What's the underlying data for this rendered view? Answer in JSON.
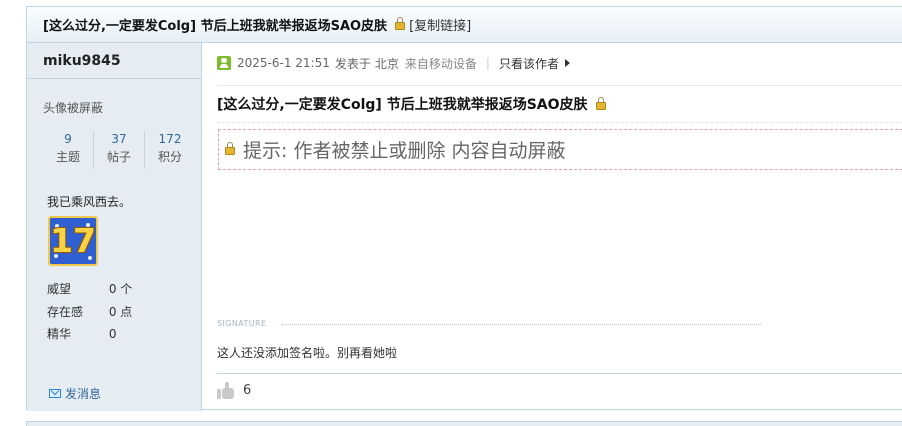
{
  "thread": {
    "title": "[这么过分,一定要发Colg] 节后上班我就举报返场SAO皮肤",
    "copy_link": "[复制链接]"
  },
  "author": {
    "name": "miku9845",
    "avatar_status": "头像被屏蔽",
    "stats": [
      {
        "value": "9",
        "label": "主题"
      },
      {
        "value": "37",
        "label": "帖子"
      },
      {
        "value": "172",
        "label": "积分"
      }
    ],
    "status_text": "我已乘风西去。",
    "medal": {
      "text": "17"
    },
    "attributes": [
      {
        "key": "威望",
        "value": "0 个"
      },
      {
        "key": "存在感",
        "value": "0 点"
      },
      {
        "key": "精华",
        "value": "0"
      }
    ],
    "message_link": "发消息"
  },
  "post": {
    "date": "2025-6-1 21:51",
    "posted_at_label": "发表于",
    "location": "北京",
    "device": "来自移动设备",
    "only_author": "只看该作者",
    "title": "[这么过分,一定要发Colg] 节后上班我就举报返场SAO皮肤",
    "locked_notice": "提示: 作者被禁止或删除 内容自动屏蔽",
    "signature_label": "SIGNATURE",
    "signature_text": "这人还没添加签名啦。别再看她啦",
    "likes": "6"
  },
  "colors": {
    "border": "#c2d5e3",
    "sidebar_bg": "#e5edf2",
    "link": "#336699",
    "user_icon": "#7cbb2b",
    "locked_border": "#e6a0a8"
  }
}
